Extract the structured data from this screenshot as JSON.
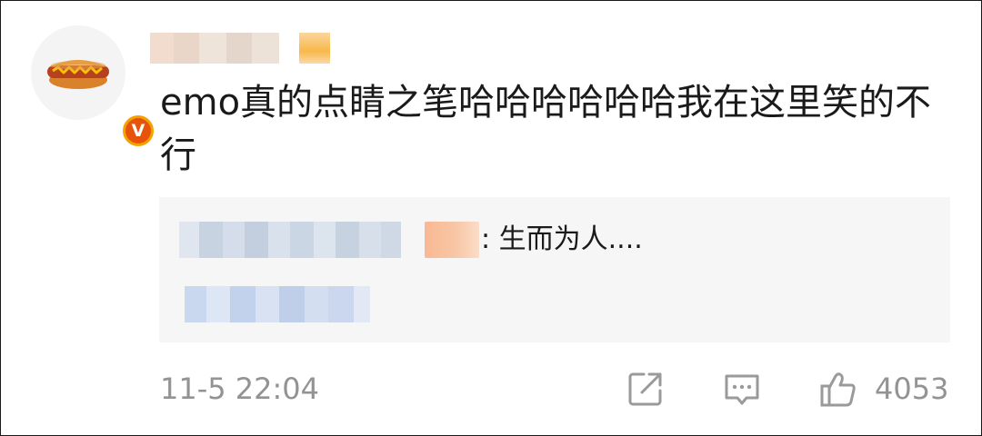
{
  "comment": {
    "text": "emo真的点睛之笔哈哈哈哈哈哈我在这里笑的不行",
    "timestamp": "11-5 22:04",
    "like_count": "4053",
    "avatar_icon": "hotdog-avatar",
    "badge_label": "V"
  },
  "reply": {
    "text": ": 生而为人...."
  },
  "actions": {
    "share_icon": "share-icon",
    "comment_icon": "comment-icon",
    "like_icon": "thumbs-up-icon"
  },
  "colors": {
    "badge_outer": "#f5a200",
    "badge_inner": "#e8530a",
    "muted_text": "#939393",
    "reply_bg": "#f6f6f6"
  }
}
